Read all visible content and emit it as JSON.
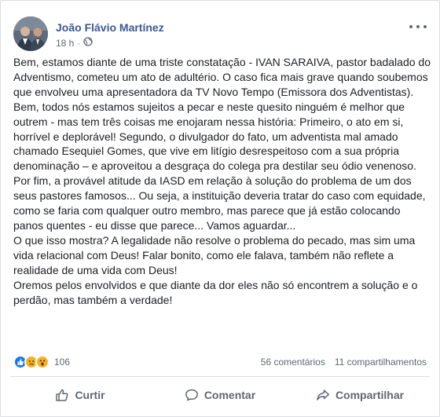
{
  "post": {
    "author": "João Flávio Martínez",
    "time": "18 h",
    "separator": "·",
    "paragraphs": [
      "Bem, estamos diante de uma triste constatação - IVAN SARAIVA, pastor badalado do Adventismo, cometeu um ato de adultério. O caso fica mais grave quando soubemos que envolveu uma apresentadora da TV Novo Tempo (Emissora dos Adventistas). Bem, todos nós estamos sujeitos a pecar e neste quesito ninguém é melhor que outrem - mas tem três coisas me enojaram nessa história: Primeiro, o ato em si, horrível e deplorável! Segundo, o divulgador do fato, um adventista mal amado chamado Esequiel Gomes, que vive em litígio desrespeitoso com a sua própria denominação – e aproveitou a desgraça do colega pra destilar seu ódio venenoso. Por fim, a provável atitude da IASD em relação à solução do problema de um dos seus pastores famosos... Ou seja, a instituição deveria tratar do caso com equidade, como se faria com qualquer outro membro, mas parece que já estão colocando panos quentes - eu disse que parece... Vamos aguardar...",
      "O que isso mostra? A legalidade não resolve o problema do pecado, mas sim uma vida relacional com Deus! Falar bonito, como ele falava, também não reflete a realidade de uma vida com Deus!",
      "Oremos pelos envolvidos e que diante da dor eles não só encontrem a solução e o perdão, mas também a verdade!"
    ]
  },
  "reactions": {
    "count": "106",
    "comments": "56 comentários",
    "shares": "11 compartilhamentos",
    "icons": [
      "like-icon",
      "sad-icon",
      "wow-icon"
    ]
  },
  "actions": {
    "like": "Curtir",
    "comment": "Comentar",
    "share": "Compartilhar"
  },
  "colors": {
    "author": "#385898",
    "muted": "#606770",
    "like_blue": "#1877f2",
    "emoji_yellow": "#f7b125"
  }
}
